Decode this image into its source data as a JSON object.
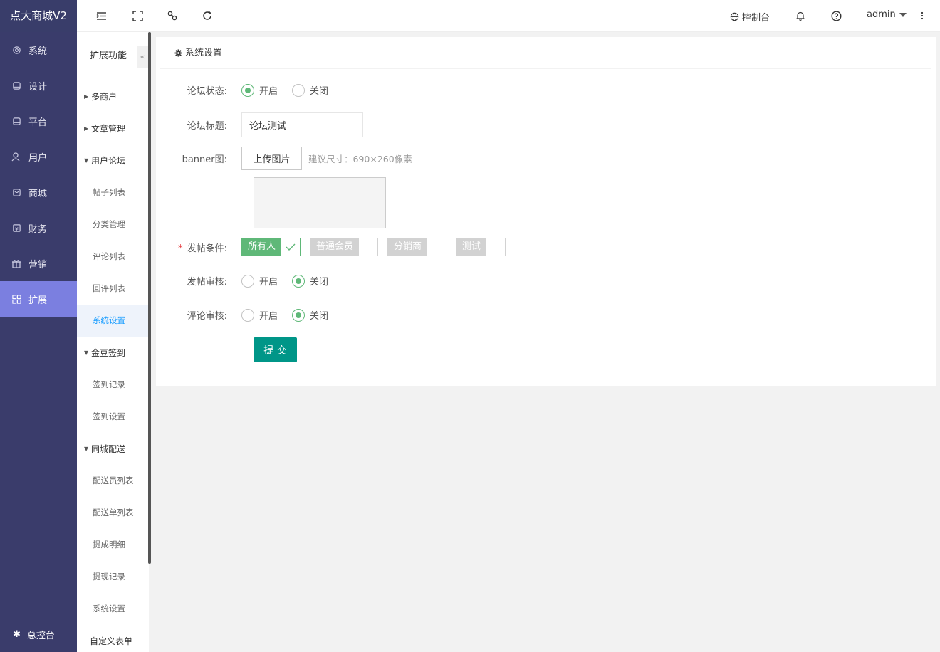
{
  "brand": "点大商城V2",
  "nav": [
    {
      "label": "系统",
      "icon": "gear-icon"
    },
    {
      "label": "设计",
      "icon": "monitor-icon"
    },
    {
      "label": "平台",
      "icon": "tablet-icon"
    },
    {
      "label": "用户",
      "icon": "user-icon"
    },
    {
      "label": "商城",
      "icon": "shop-icon"
    },
    {
      "label": "财务",
      "icon": "finance-icon"
    },
    {
      "label": "营销",
      "icon": "gift-icon"
    },
    {
      "label": "扩展",
      "icon": "grid-icon"
    }
  ],
  "nav_bottom": "总控台",
  "sub_sidebar": {
    "title": "扩展功能",
    "collapse": "«",
    "groups": [
      {
        "label": "多商户"
      },
      {
        "label": "文章管理"
      },
      {
        "label": "用户论坛",
        "items": [
          "帖子列表",
          "分类管理",
          "评论列表",
          "回评列表",
          "系统设置"
        ]
      },
      {
        "label": "金豆签到",
        "items": [
          "签到记录",
          "签到设置"
        ]
      },
      {
        "label": "同城配送",
        "items": [
          "配送员列表",
          "配送单列表",
          "提成明细",
          "提现记录",
          "系统设置"
        ]
      },
      {
        "label": "自定义表单"
      }
    ]
  },
  "topbar": {
    "console": "控制台",
    "user": "admin"
  },
  "card": {
    "title": "系统设置",
    "forum_status": {
      "label": "论坛状态:",
      "on": "开启",
      "off": "关闭",
      "selected": "on"
    },
    "forum_title": {
      "label": "论坛标题:",
      "value": "论坛测试"
    },
    "banner": {
      "label": "banner图:",
      "button": "上传图片",
      "hint": "建议尺寸：690×260像素"
    },
    "post_condition": {
      "label": "发帖条件:",
      "options": [
        {
          "text": "所有人",
          "checked": true
        },
        {
          "text": "普通会员",
          "checked": false
        },
        {
          "text": "分销商",
          "checked": false
        },
        {
          "text": "测试",
          "checked": false
        }
      ]
    },
    "post_review": {
      "label": "发帖审核:",
      "on": "开启",
      "off": "关闭",
      "selected": "off"
    },
    "comment_review": {
      "label": "评论审核:",
      "on": "开启",
      "off": "关闭",
      "selected": "off"
    },
    "submit": "提 交"
  },
  "colors": {
    "sidebar": "#3a3c6b",
    "active_nav": "#7b7fe0",
    "green": "#5fb878",
    "submit": "#009688"
  }
}
